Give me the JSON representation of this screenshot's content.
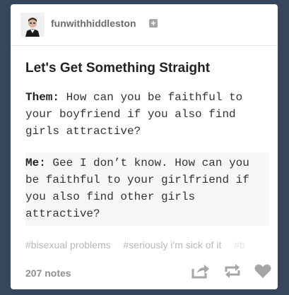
{
  "post": {
    "username": "funwithhiddleston",
    "title": "Let's Get Something Straight",
    "them_label": "Them:",
    "them_text": "How can you be faithful to your boyfriend if you also find girls attractive?",
    "me_label": "Me:",
    "me_text": "Gee I don’t know. How can you be faithful to your girlfriend if you also find other girls attractive?",
    "tags": [
      "#bisexual problems",
      "#seriously i'm sick of it",
      "#b"
    ],
    "notes": "207 notes"
  },
  "icons": {
    "follow": "plus-icon",
    "share": "share-icon",
    "reblog": "reblog-icon",
    "like": "heart-icon"
  },
  "colors": {
    "background": "#36465d",
    "card": "#ffffff",
    "tag": "#b8b8b8",
    "icon": "#a6a6a6"
  }
}
